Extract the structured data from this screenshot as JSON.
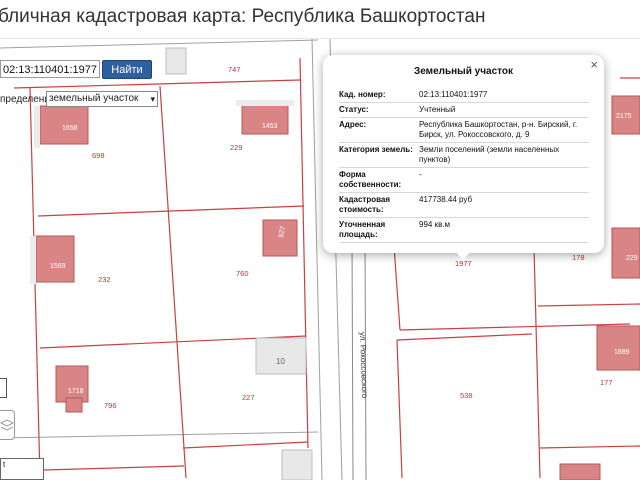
{
  "page": {
    "title": "бличная кадастровая карта: Республика Башкортостан"
  },
  "search": {
    "value": "02:13:110401:1977",
    "button": "Найти"
  },
  "definition": {
    "label": "пределение:",
    "selected": "земельный участок"
  },
  "scale": {
    "line1": "t"
  },
  "map": {
    "street": "ул. Рокоссовского",
    "parcel_numbers": [
      "747",
      "698",
      "229",
      "232",
      "760",
      "796",
      "227",
      "538",
      "177",
      "178",
      "1977"
    ],
    "building_numbers": [
      "1658",
      "1453",
      "1569",
      "927",
      "1718",
      "2175",
      "229",
      "1889",
      "10"
    ]
  },
  "popup": {
    "title": "Земельный участок",
    "close": "×",
    "rows": [
      {
        "key": "Кад. номер:",
        "value": "02:13:110401:1977"
      },
      {
        "key": "Статус:",
        "value": "Учтенный"
      },
      {
        "key": "Адрес:",
        "value": "Республика Башкортостан, р-н. Бирский, г. Бирск, ул. Рокоссовского, д. 9"
      },
      {
        "key": "Категория земель:",
        "value": "Земли поселений (земли населенных пунктов)"
      },
      {
        "key": "Форма собственности:",
        "value": "-"
      },
      {
        "key": "Кадастровая стоимость:",
        "value": "417738.44 руб"
      },
      {
        "key": "Уточненная площадь:",
        "value": "994 кв.м"
      }
    ]
  },
  "colors": {
    "parcel_line": "#c94040",
    "building_fill": "#d98585",
    "button": "#2e5f9e"
  }
}
